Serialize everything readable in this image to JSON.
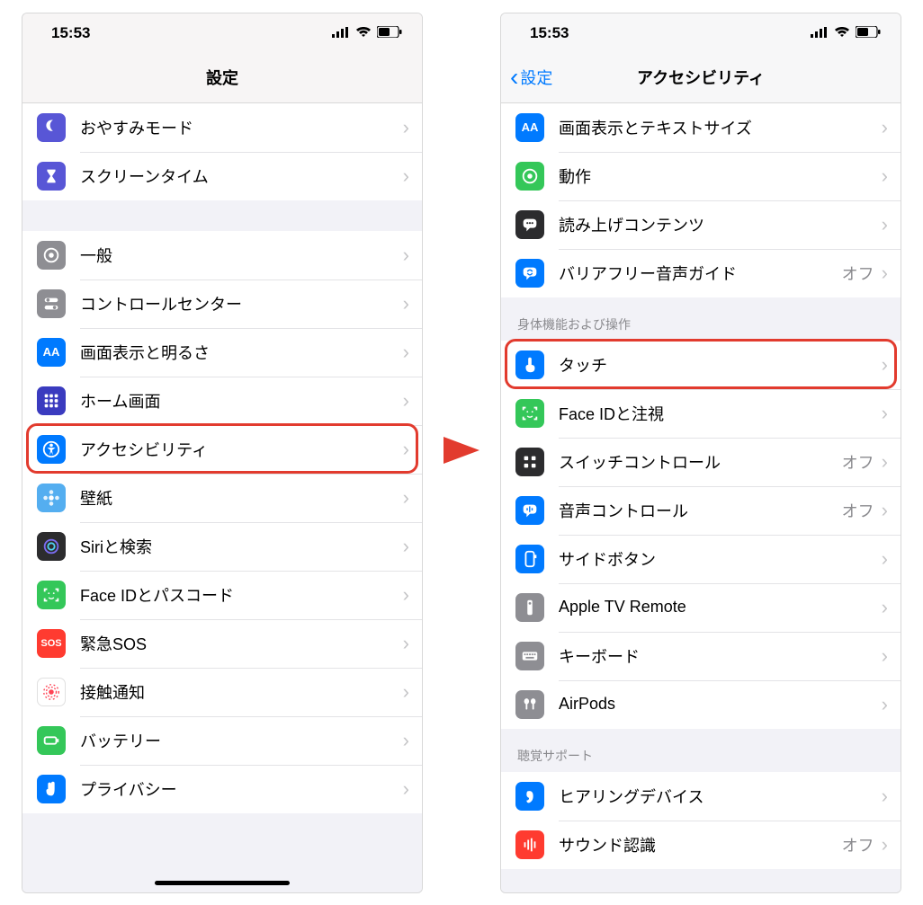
{
  "status": {
    "time": "15:53"
  },
  "left": {
    "title": "設定",
    "group1": [
      {
        "label": "おやすみモード"
      },
      {
        "label": "スクリーンタイム"
      }
    ],
    "group2": [
      {
        "label": "一般"
      },
      {
        "label": "コントロールセンター"
      },
      {
        "label": "画面表示と明るさ"
      },
      {
        "label": "ホーム画面"
      },
      {
        "label": "アクセシビリティ"
      },
      {
        "label": "壁紙"
      },
      {
        "label": "Siriと検索"
      },
      {
        "label": "Face IDとパスコード"
      },
      {
        "label": "緊急SOS"
      },
      {
        "label": "接触通知"
      },
      {
        "label": "バッテリー"
      },
      {
        "label": "プライバシー"
      }
    ]
  },
  "right": {
    "back": "設定",
    "title": "アクセシビリティ",
    "group1": [
      {
        "label": "画面表示とテキストサイズ",
        "detail": ""
      },
      {
        "label": "動作",
        "detail": ""
      },
      {
        "label": "読み上げコンテンツ",
        "detail": ""
      },
      {
        "label": "バリアフリー音声ガイド",
        "detail": "オフ"
      }
    ],
    "header2": "身体機能および操作",
    "group2": [
      {
        "label": "タッチ",
        "detail": ""
      },
      {
        "label": "Face IDと注視",
        "detail": ""
      },
      {
        "label": "スイッチコントロール",
        "detail": "オフ"
      },
      {
        "label": "音声コントロール",
        "detail": "オフ"
      },
      {
        "label": "サイドボタン",
        "detail": ""
      },
      {
        "label": "Apple TV Remote",
        "detail": ""
      },
      {
        "label": "キーボード",
        "detail": ""
      },
      {
        "label": "AirPods",
        "detail": ""
      }
    ],
    "header3": "聴覚サポート",
    "group3": [
      {
        "label": "ヒアリングデバイス",
        "detail": ""
      },
      {
        "label": "サウンド認識",
        "detail": "オフ"
      }
    ]
  }
}
